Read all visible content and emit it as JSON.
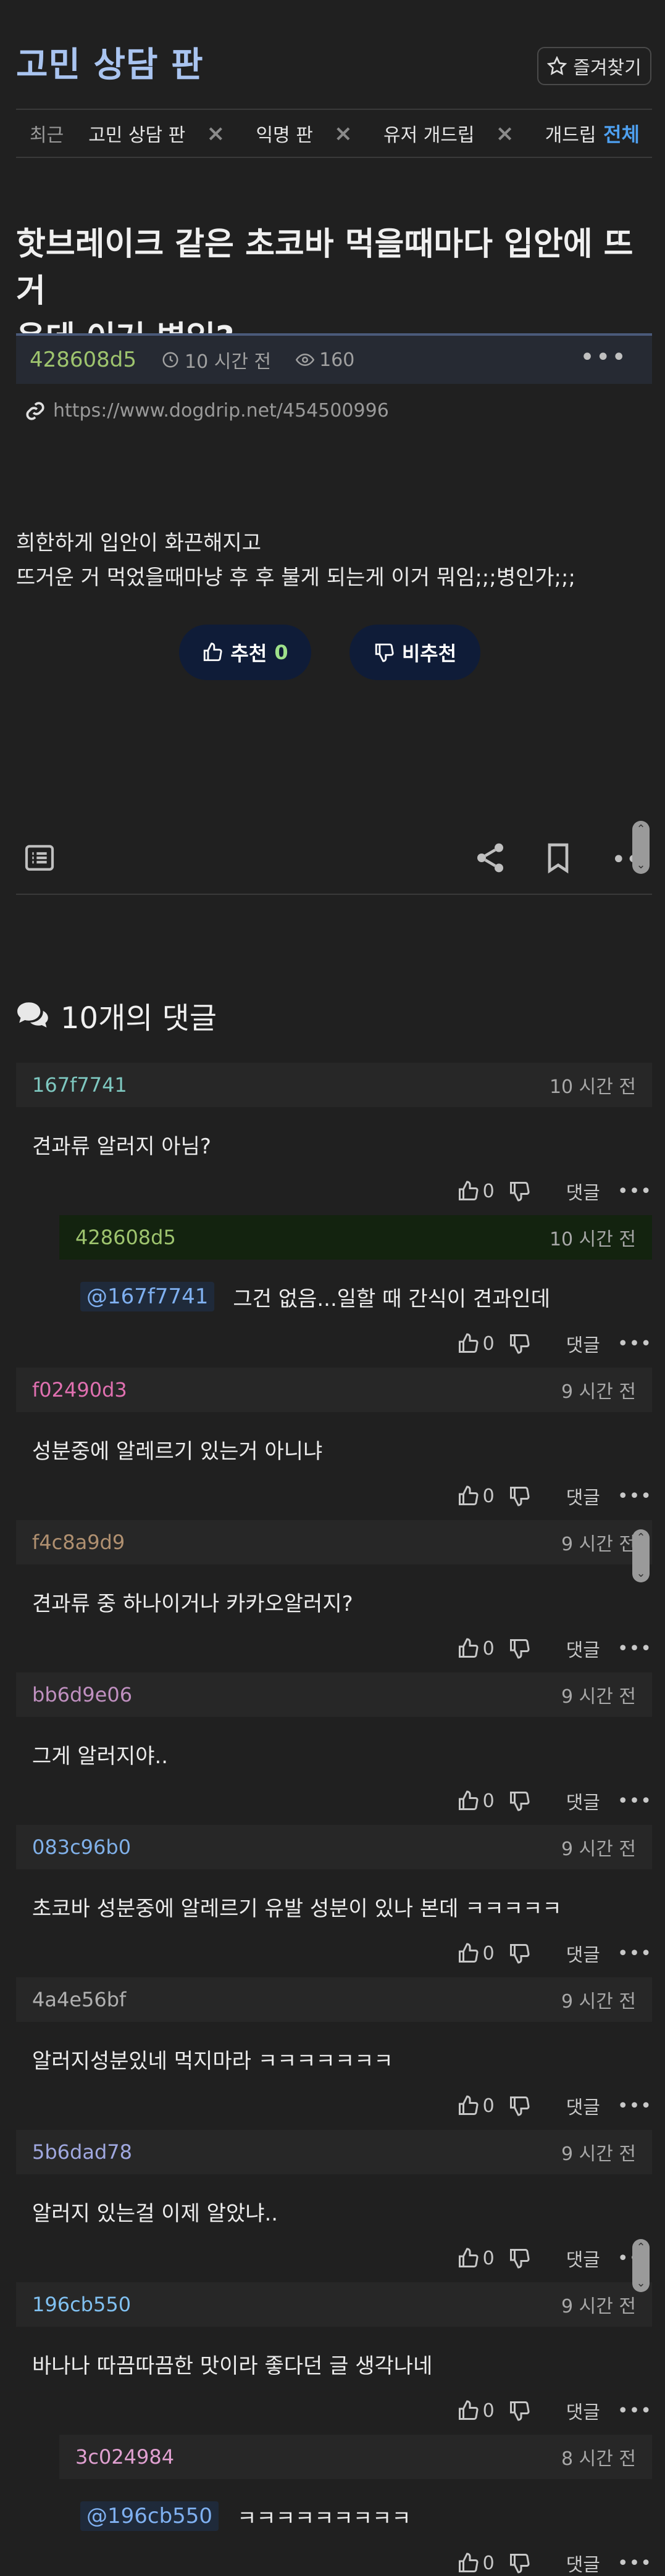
{
  "header": {
    "board_title": "고민 상담 판",
    "favorite_label": "즐겨찾기"
  },
  "recent": {
    "label": "최근",
    "items": [
      "고민 상담 판",
      "익명 판",
      "유저 개드립"
    ],
    "last_item": "개드립",
    "all_label": "전체"
  },
  "post": {
    "title_line1": "핫브레이크 같은 초코바 먹을때마다 입안에 뜨거",
    "title_line2": "운데 이거 병임?",
    "author": "428608d5",
    "time": "10 시간 전",
    "views": "160",
    "url": "https://www.dogdrip.net/454500996",
    "body_line1": "희한하게 입안이 화끈해지고",
    "body_line2": "뜨거운 거 먹었을때마냥 후 후 불게 되는게 이거 뭐임;;;병인가;;;",
    "upvote_label": "추천",
    "upvote_count": "0",
    "downvote_label": "비추천"
  },
  "comments": {
    "heading": "10개의 댓글",
    "reply_label": "댓글",
    "items": [
      {
        "author": "167f7741",
        "author_color": "#7ec8c0",
        "time": "10 시간 전",
        "mention": "",
        "text": "견과류 알러지 아님?",
        "likes": "0",
        "nested": false
      },
      {
        "author": "428608d5",
        "author_color": "#9ec46e",
        "time": "10 시간 전",
        "mention": "@167f7741",
        "text": "그건 없음...일할 때 간식이 견과인데",
        "likes": "0",
        "nested": true,
        "op": true
      },
      {
        "author": "f02490d3",
        "author_color": "#e070b0",
        "time": "9 시간 전",
        "mention": "",
        "text": "성분중에 알레르기 있는거 아니냐",
        "likes": "0",
        "nested": false
      },
      {
        "author": "f4c8a9d9",
        "author_color": "#b09070",
        "time": "9 시간 전",
        "mention": "",
        "text": "견과류 중 하나이거나 카카오알러지?",
        "likes": "0",
        "nested": false
      },
      {
        "author": "bb6d9e06",
        "author_color": "#c090c0",
        "time": "9 시간 전",
        "mention": "",
        "text": "그게 알러지야..",
        "likes": "0",
        "nested": false
      },
      {
        "author": "083c96b0",
        "author_color": "#80b0e8",
        "time": "9 시간 전",
        "mention": "",
        "text": "초코바 성분중에 알레르기 유발 성분이 있나 본데 ㅋㅋㅋㅋㅋ",
        "likes": "0",
        "nested": false
      },
      {
        "author": "4a4e56bf",
        "author_color": "#b0b0b0",
        "time": "9 시간 전",
        "mention": "",
        "text": "알러지성분있네 먹지마라 ㅋㅋㅋㅋㅋㅋㅋ",
        "likes": "0",
        "nested": false
      },
      {
        "author": "5b6dad78",
        "author_color": "#a0a8e0",
        "time": "9 시간 전",
        "mention": "",
        "text": "알러지 있는걸 이제 알았냐..",
        "likes": "0",
        "nested": false
      },
      {
        "author": "196cb550",
        "author_color": "#80c0f0",
        "time": "9 시간 전",
        "mention": "",
        "text": "바나나 따끔따끔한 맛이라 좋다던 글 생각나네",
        "likes": "0",
        "nested": false
      },
      {
        "author": "3c024984",
        "author_color": "#e0a0d0",
        "time": "8 시간 전",
        "mention": "@196cb550",
        "text": "ㅋㅋㅋㅋㅋㅋㅋㅋㅋ",
        "likes": "0",
        "nested": true
      }
    ]
  }
}
